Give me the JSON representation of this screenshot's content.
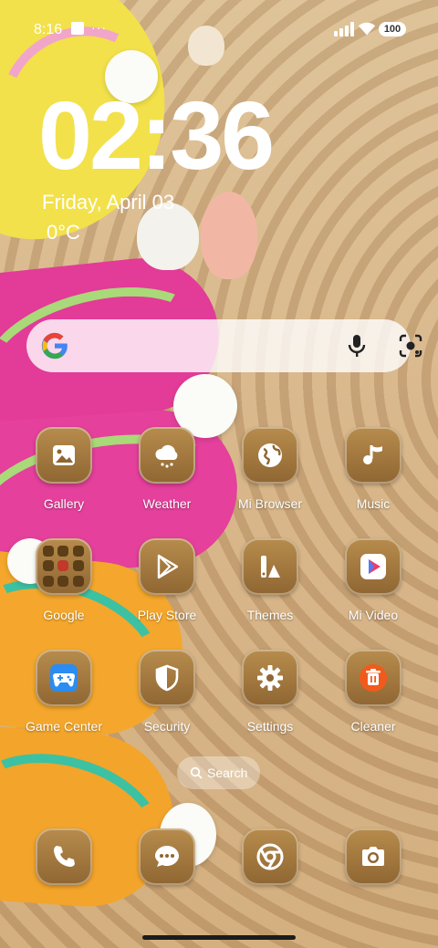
{
  "status_bar": {
    "time": "8:16",
    "battery": "100"
  },
  "clock": {
    "time": "02:36",
    "date": "Friday, April 03",
    "temperature": "0°C"
  },
  "search_bar": {
    "google_icon": "google-g-icon",
    "mic_icon": "microphone-icon",
    "lens_icon": "camera-lens-icon"
  },
  "apps": [
    {
      "label": "Gallery",
      "icon": "image-icon"
    },
    {
      "label": "Weather",
      "icon": "cloud-icon"
    },
    {
      "label": "Mi Browser",
      "icon": "globe-icon"
    },
    {
      "label": "Music",
      "icon": "music-note-icon"
    },
    {
      "label": "Google",
      "icon": "folder-icon"
    },
    {
      "label": "Play Store",
      "icon": "play-icon"
    },
    {
      "label": "Themes",
      "icon": "themes-icon"
    },
    {
      "label": "Mi Video",
      "icon": "video-play-icon"
    },
    {
      "label": "Game Center",
      "icon": "gamepad-icon"
    },
    {
      "label": "Security",
      "icon": "shield-icon"
    },
    {
      "label": "Settings",
      "icon": "gear-icon"
    },
    {
      "label": "Cleaner",
      "icon": "trash-icon"
    }
  ],
  "app_search": {
    "label": "Search"
  },
  "dock": [
    {
      "icon": "phone-icon"
    },
    {
      "icon": "message-icon"
    },
    {
      "icon": "chrome-icon"
    },
    {
      "icon": "camera-icon"
    }
  ]
}
